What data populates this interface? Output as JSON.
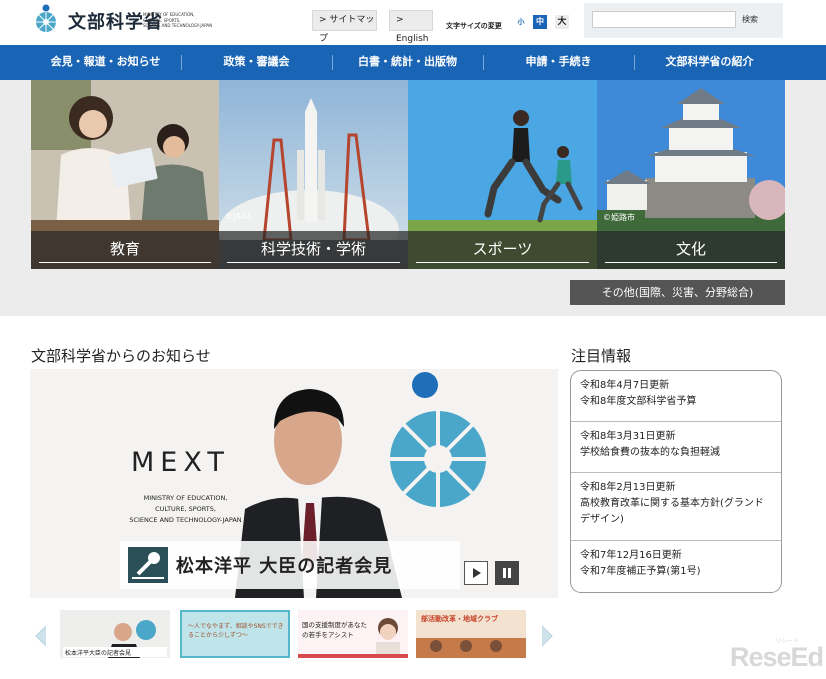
{
  "header": {
    "logo_text": "文部科学省",
    "logo_sub": "MINISTRY OF EDUCATION,\nCULTURE, SPORTS,\nSCIENCE AND TECHNOLOGY-JAPAN",
    "sitemap_label": "> サイトマップ",
    "english_label": "> English",
    "fontsize_label": "文字サイズの変更",
    "fontsize_small": "小",
    "fontsize_mid": "中",
    "fontsize_large": "大",
    "search_placeholder": "",
    "search_button": "検索"
  },
  "nav": {
    "items": [
      {
        "label": "会見・報道・お知らせ"
      },
      {
        "label": "政策・審議会"
      },
      {
        "label": "白書・統計・出版物"
      },
      {
        "label": "申請・手続き"
      },
      {
        "label": "文部科学省の紹介"
      }
    ]
  },
  "hero": {
    "tiles": [
      {
        "label": "教育"
      },
      {
        "label": "科学技術・学術",
        "credit": "©JAXA"
      },
      {
        "label": "スポーツ"
      },
      {
        "label": "文化",
        "credit": "©姫路市"
      }
    ],
    "other_label": "その他(国際、災害、分野総合)"
  },
  "news": {
    "title": "文部科学省からのお知らせ",
    "slide": {
      "mext_logo": "MEXT",
      "mext_sub": "MINISTRY OF EDUCATION,\nCULTURE, SPORTS,\nSCIENCE AND TECHNOLOGY-JAPAN",
      "press_title": "松本洋平 大臣の記者会見"
    },
    "thumbs": [
      {
        "text": "松本洋平大臣の記者会見"
      },
      {
        "text": "～人でなやまず、相談やSNSでできることから少しずつ～"
      },
      {
        "text": "国の支援制度があなたの若手をアシスト"
      },
      {
        "text": "部活動改革・地域クラブ"
      }
    ]
  },
  "focus": {
    "title": "注目情報",
    "items": [
      {
        "date": "令和8年4月7日更新",
        "text": "令和8年度文部科学省予算"
      },
      {
        "date": "令和8年3月31日更新",
        "text": "学校給食費の抜本的な負担軽減"
      },
      {
        "date": "令和8年2月13日更新",
        "text": "高校教育改革に関する基本方針(グランドデザイン)"
      },
      {
        "date": "令和7年12月16日更新",
        "text": "令和7年度補正予算(第1号)"
      }
    ]
  },
  "watermark": {
    "text": "ReseEd",
    "sub": "リシード"
  },
  "colors": {
    "nav_blue": "#1a64b5",
    "logo_teal": "#4aa7c9",
    "hero_bg": "#ececec"
  }
}
